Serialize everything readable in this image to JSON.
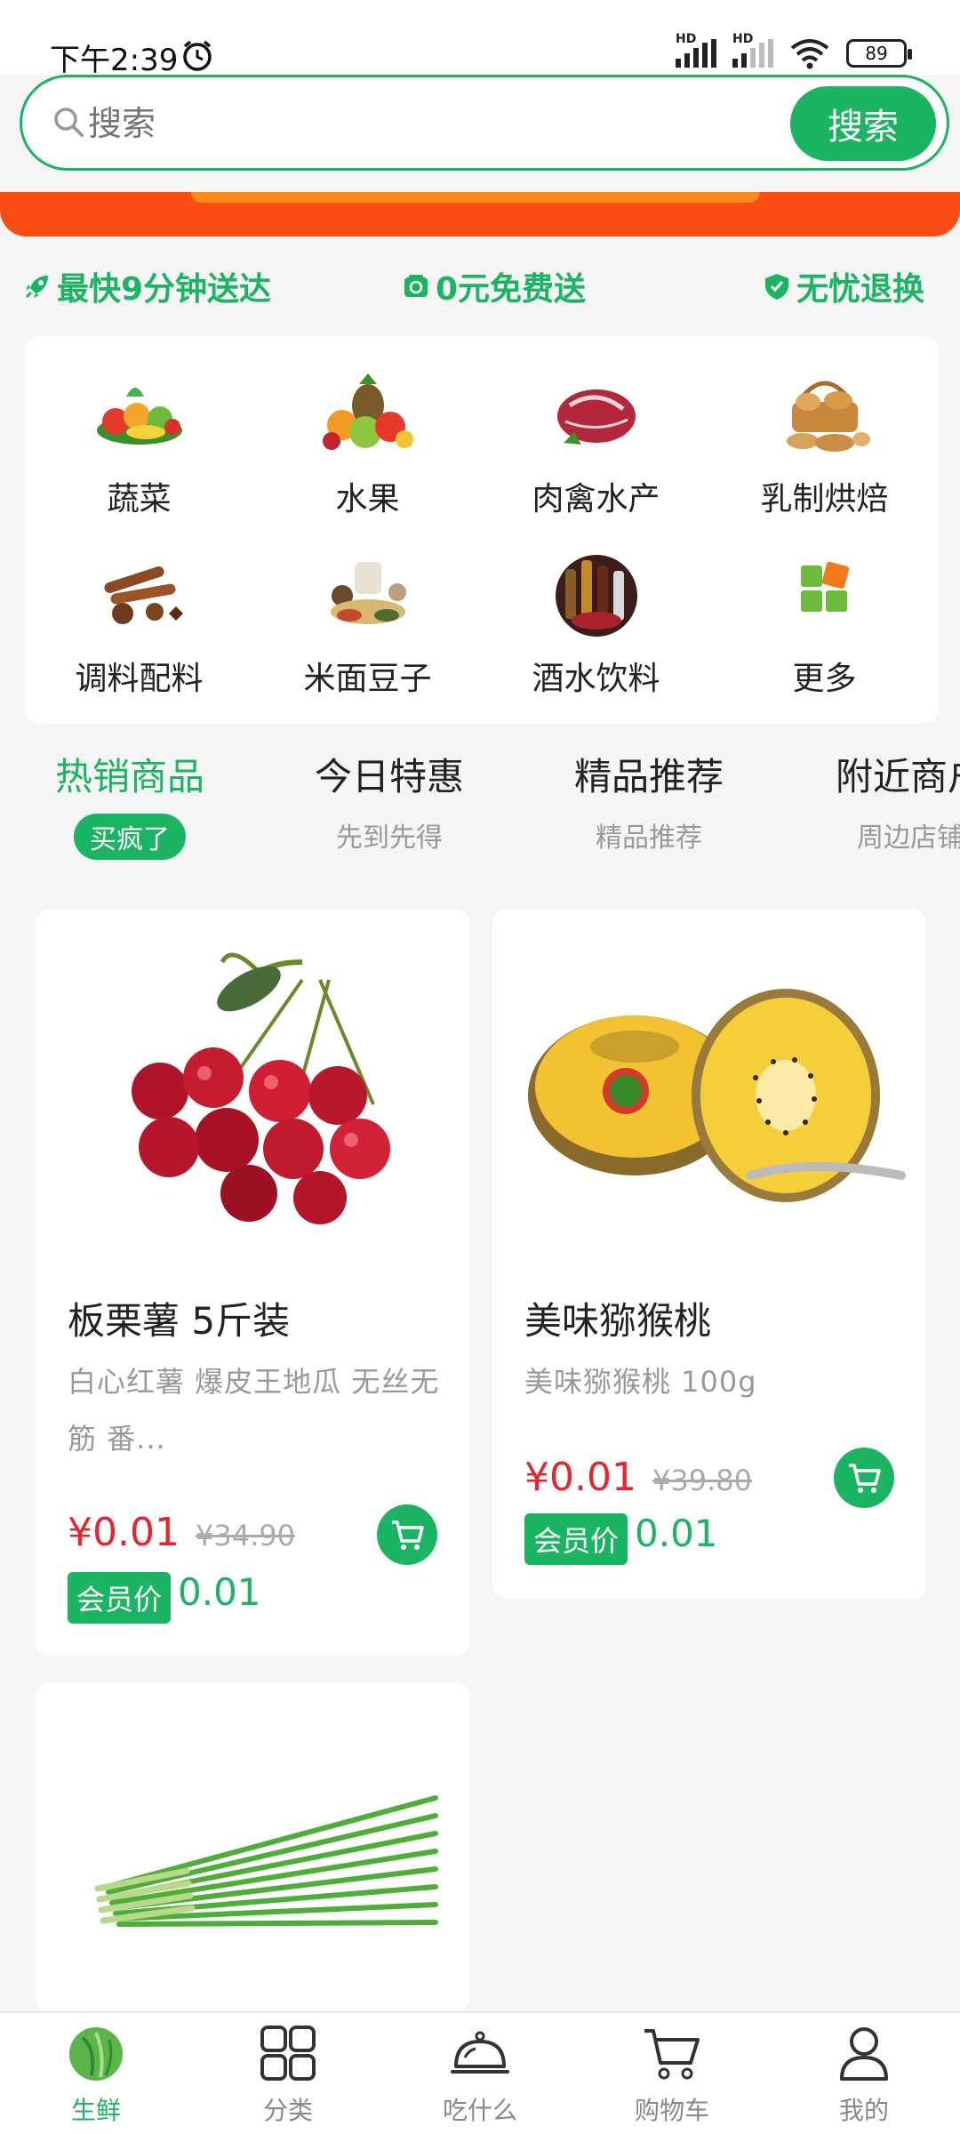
{
  "status_bar": {
    "time": "下午2:39",
    "battery": "89",
    "signal_tag": "HD"
  },
  "search": {
    "placeholder": "搜索",
    "button": "搜索"
  },
  "promos": [
    {
      "icon": "rocket-icon",
      "label": "最快9分钟送达"
    },
    {
      "icon": "wallet-icon",
      "label": "0元免费送"
    },
    {
      "icon": "shield-check-icon",
      "label": "无忧退换"
    }
  ],
  "categories": [
    {
      "label": "蔬菜",
      "icon": "vegetables-image"
    },
    {
      "label": "水果",
      "icon": "fruits-image"
    },
    {
      "label": "肉禽水产",
      "icon": "meat-image"
    },
    {
      "label": "乳制烘焙",
      "icon": "bakery-image"
    },
    {
      "label": "调料配料",
      "icon": "spices-image"
    },
    {
      "label": "米面豆子",
      "icon": "grains-image"
    },
    {
      "label": "酒水饮料",
      "icon": "drinks-image"
    },
    {
      "label": "更多",
      "icon": "more-icon"
    }
  ],
  "tabs": [
    {
      "title": "热销商品",
      "sub": "买疯了",
      "active": true
    },
    {
      "title": "今日特惠",
      "sub": "先到先得"
    },
    {
      "title": "精品推荐",
      "sub": "精品推荐"
    },
    {
      "title": "附近商户",
      "sub": "周边店铺"
    }
  ],
  "products": [
    {
      "title": "板栗薯 5斤装",
      "desc": "白心红薯 爆皮王地瓜 无丝无筋 番...",
      "price": "¥0.01",
      "old_price": "¥34.90",
      "member_label": "会员价",
      "member_price": "0.01",
      "image": "cherries-image"
    },
    {
      "title": "美味猕猴桃",
      "desc": "美味猕猴桃 100g",
      "price": "¥0.01",
      "old_price": "¥39.80",
      "member_label": "会员价",
      "member_price": "0.01",
      "image": "golden-kiwi-image"
    },
    {
      "title": "",
      "image": "chives-image"
    }
  ],
  "bottom_nav": [
    {
      "label": "生鲜",
      "icon": "cabbage-icon",
      "active": true
    },
    {
      "label": "分类",
      "icon": "grid-icon"
    },
    {
      "label": "吃什么",
      "icon": "cloche-icon"
    },
    {
      "label": "购物车",
      "icon": "cart-icon"
    },
    {
      "label": "我的",
      "icon": "user-icon"
    }
  ],
  "colors": {
    "brand": "#1bb463",
    "price": "#e4262e",
    "banner": "#fb4c14"
  }
}
